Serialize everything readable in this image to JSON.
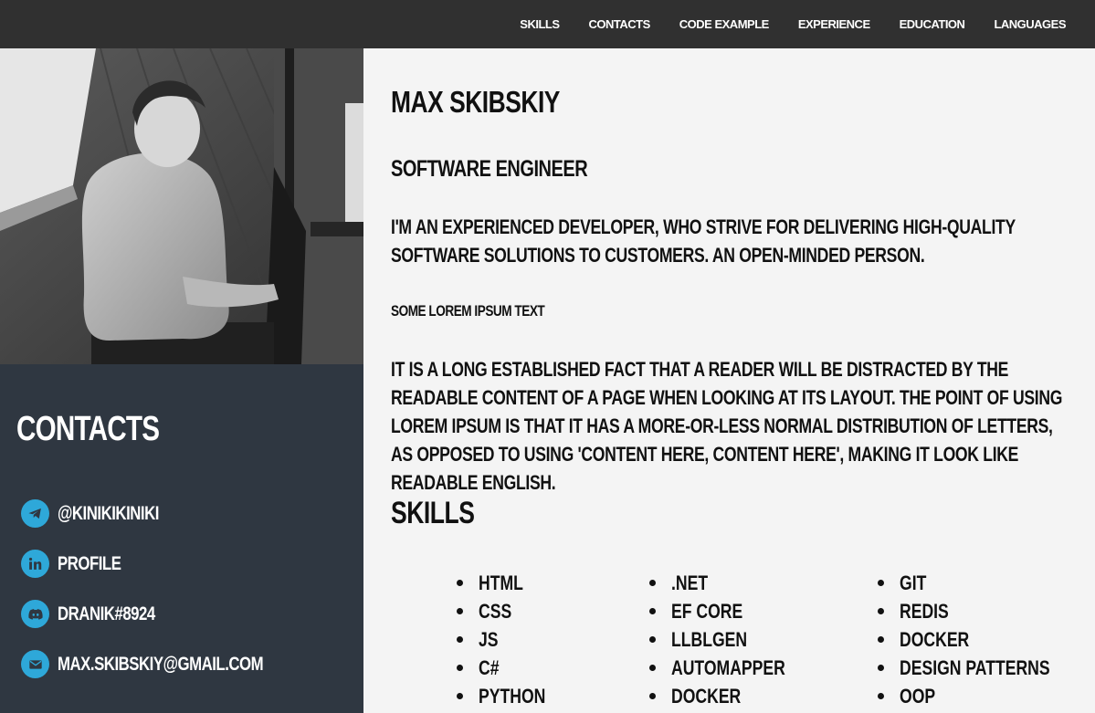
{
  "nav": {
    "items": [
      "SKILLS",
      "CONTACTS",
      "CODE EXAMPLE",
      "EXPERIENCE",
      "EDUCATION",
      "LANGUAGES"
    ]
  },
  "sidebar": {
    "title": "CONTACTS",
    "contacts": [
      {
        "icon": "telegram-icon",
        "label": "@KINIKIKINIKI"
      },
      {
        "icon": "linkedin-icon",
        "label": "PROFILE"
      },
      {
        "icon": "discord-icon",
        "label": "DRANIK#8924"
      },
      {
        "icon": "mail-icon",
        "label": "MAX.SKIBSKIY@GMAIL.COM"
      }
    ],
    "accent": "#2ea8d9",
    "background": "#2f3741"
  },
  "main": {
    "name": "MAX SKIBSKIY",
    "role": "SOFTWARE ENGINEER",
    "about": "I'M AN EXPERIENCED DEVELOPER, WHO STRIVE FOR DELIVERING HIGH-QUALITY SOFTWARE SOLUTIONS TO CUSTOMERS. AN OPEN-MINDED PERSON.",
    "subhead": "SOME LOREM IPSUM TEXT",
    "lorem": "IT IS A LONG ESTABLISHED FACT THAT A READER WILL BE DISTRACTED BY THE READABLE CONTENT OF A PAGE WHEN LOOKING AT ITS LAYOUT. THE POINT OF USING LOREM IPSUM IS THAT IT HAS A MORE-OR-LESS NORMAL DISTRIBUTION OF LETTERS, AS OPPOSED TO USING 'CONTENT HERE, CONTENT HERE', MAKING IT LOOK LIKE READABLE ENGLISH.",
    "skills_title": "SKILLS",
    "skills": [
      [
        "HTML",
        "CSS",
        "JS",
        "C#",
        "PYTHON"
      ],
      [
        ".NET",
        "EF CORE",
        "LLBLGEN",
        "AUTOMAPPER",
        "DOCKER"
      ],
      [
        "GIT",
        "REDIS",
        "DOCKER",
        "DESIGN PATTERNS",
        "OOP"
      ]
    ]
  },
  "colors": {
    "topbar": "#303030",
    "page": "#f4f4f4"
  }
}
